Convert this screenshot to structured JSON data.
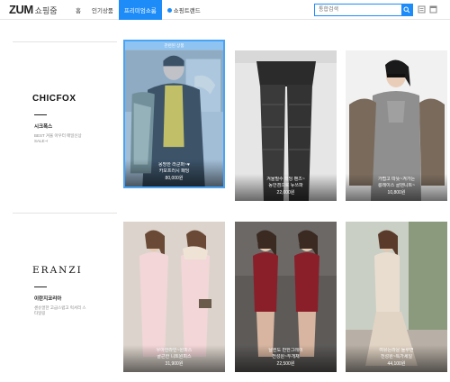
{
  "header": {
    "logo_main": "ZUM",
    "logo_sub": "쇼핑줌",
    "nav": [
      {
        "label": "홈",
        "active": false
      },
      {
        "label": "인기상품",
        "active": false
      },
      {
        "label": "프리미엄쇼룸",
        "active": true
      },
      {
        "label": "쇼핑트랜드",
        "active": false
      }
    ],
    "search_placeholder": "통합검색",
    "accent_color": "#1d8cf8"
  },
  "brands": [
    {
      "logo": "CHICFOX",
      "name": "시크폭스",
      "desc": "BEST 겨울 아우터 매일신상 SALE~!",
      "products": [
        {
          "name": "몽땅한 라쿤퍼~♥",
          "name2": "카모프러시 패딩",
          "price": "80,000원",
          "selected": true,
          "tag": "관련된 상품"
        },
        {
          "name": "겨울필수 패딩 팬츠~",
          "name2": "동안겸으로 뉴쓰파",
          "price": "22,000원"
        },
        {
          "name": "가볍고 따뜻~겨가는",
          "name2": "롱레이스 골덴니트~",
          "price": "10,800원"
        }
      ]
    },
    {
      "logo": "ERANZI",
      "name": "이란지코리아",
      "desc": "센슈얼한 고급스럽고 럭셔리 스타일링",
      "products": [
        {
          "name": "우아한라인~원피스",
          "name2": "골근한 니트원피스",
          "price": "31,900원"
        },
        {
          "name": "날씬도 반한그레이",
          "name2": "전성원~투개채",
          "price": "22,500원"
        },
        {
          "name": "여유는라운 둘루면",
          "name2": "천성원~특가세일",
          "price": "44,100원"
        }
      ]
    }
  ]
}
